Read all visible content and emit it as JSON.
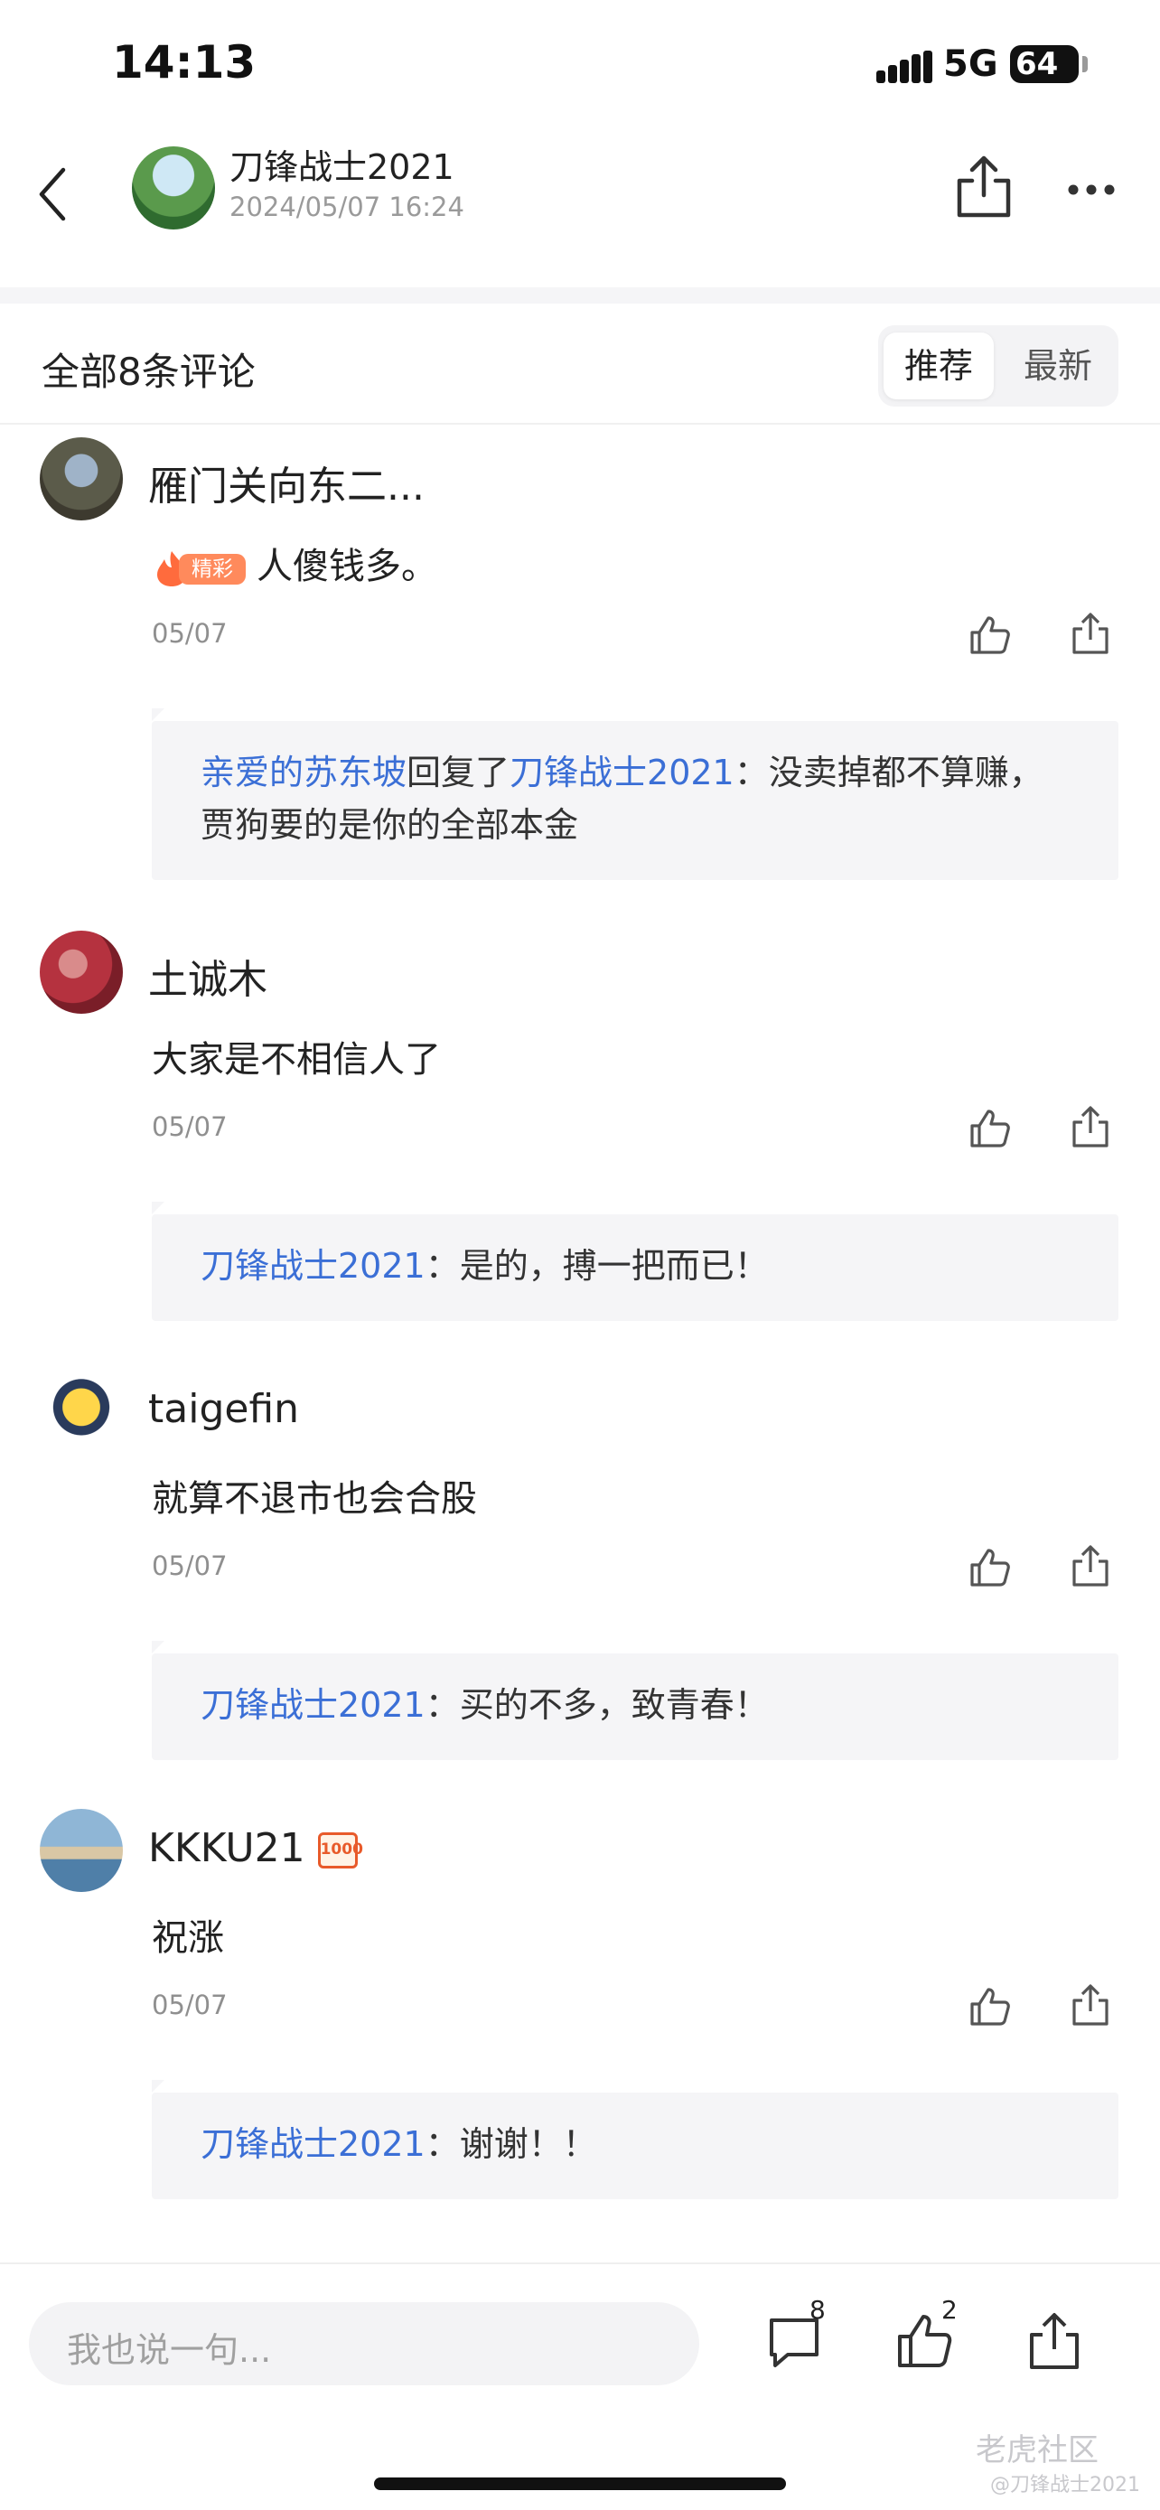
{
  "status_bar": {
    "time": "14:13",
    "network": "5G",
    "battery": "64"
  },
  "header": {
    "author": "刀锋战士2021",
    "post_time": "2024/05/07 16:24"
  },
  "comments_toolbar": {
    "count_label": "全部8条评论",
    "sort_options": [
      "推荐",
      "最新"
    ],
    "active_sort": "推荐"
  },
  "comments": [
    {
      "user": "雁门关向东二...",
      "badge": "精彩",
      "text": "人傻钱多。",
      "date": "05/07",
      "reply": {
        "author": "亲爱的苏东坡",
        "verb": "回复了",
        "target": "刀锋战士2021",
        "sep": "：",
        "text_line1": "没卖掉都不算赚，",
        "text_line2": "贾狗要的是你的全部本金"
      }
    },
    {
      "user": "土诚木",
      "text": "大家是不相信人了",
      "date": "05/07",
      "reply": {
        "author": "刀锋战士2021",
        "sep": "：",
        "text": "是的，搏一把而已！"
      }
    },
    {
      "user": "taigefin",
      "text": "就算不退市也会合股",
      "date": "05/07",
      "reply": {
        "author": "刀锋战士2021",
        "sep": "：",
        "text": "买的不多，致青春！"
      }
    },
    {
      "user": "KKKU21",
      "level_badge": "1000",
      "text": "祝涨",
      "date": "05/07",
      "reply": {
        "author": "刀锋战士2021",
        "sep": "：",
        "text": "谢谢！！"
      }
    }
  ],
  "bottom_bar": {
    "input_placeholder": "我也说一句...",
    "comment_count": "8",
    "like_count": "2"
  },
  "watermark": {
    "brand": "老虎社区",
    "user": "@刀锋战士2021"
  },
  "colors": {
    "link": "#3b6fd6",
    "hot_badge": "#ff8a5c",
    "muted": "#8f8f8f"
  }
}
